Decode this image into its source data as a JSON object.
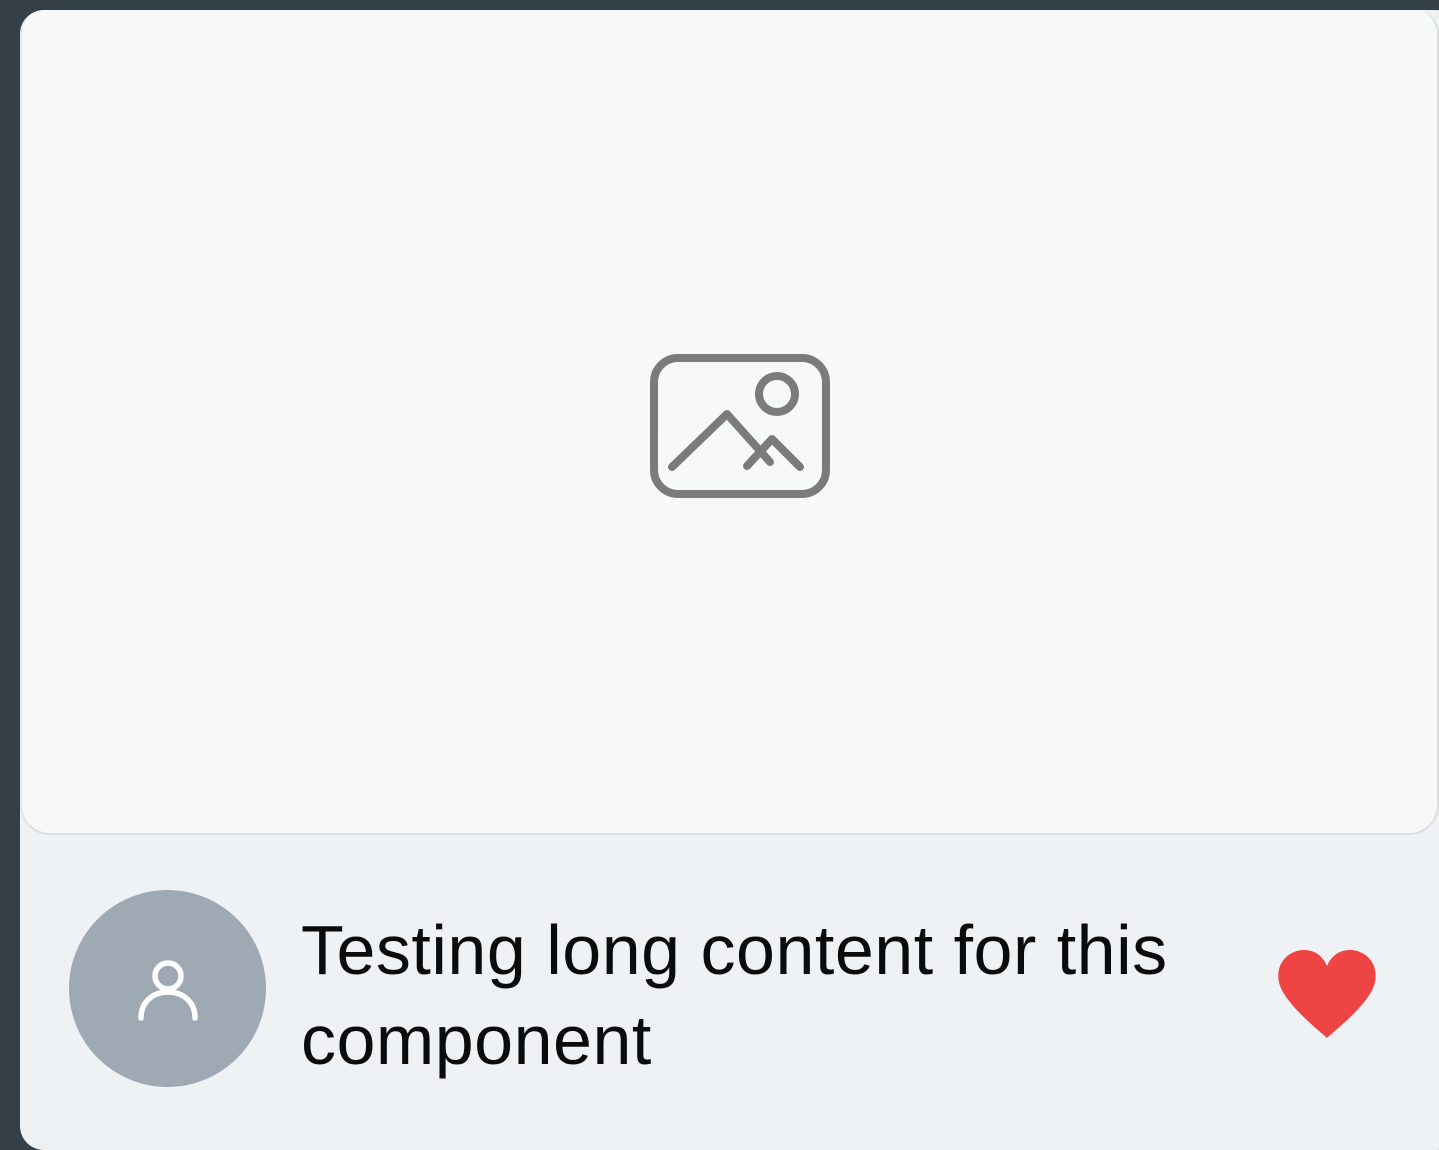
{
  "card": {
    "title": "Testing long content for this component",
    "media_icon": "image-placeholder-icon",
    "avatar_icon": "user-icon",
    "like_icon": "heart-icon",
    "like_color": "#ef4444",
    "avatar_color": "#9fa9b4"
  }
}
